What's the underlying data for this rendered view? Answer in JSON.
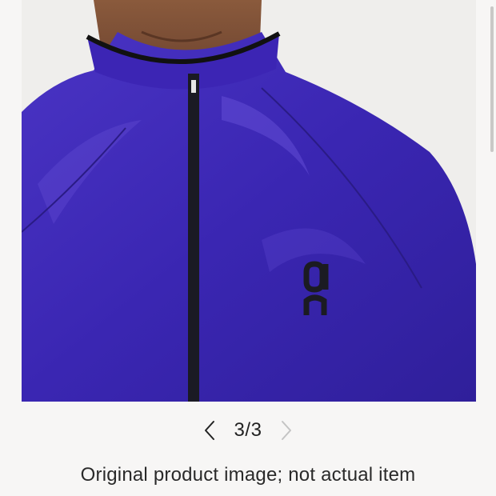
{
  "gallery": {
    "current": "3",
    "separator": "/",
    "total": "3",
    "prev_icon": "chevron-left-icon",
    "next_icon": "chevron-right-icon"
  },
  "caption": "Original product image; not actual item",
  "product_image": {
    "logo_icon": "on-brand-logo-icon",
    "jacket_color": "#3d27b4"
  },
  "colors": {
    "background": "#f7f6f5",
    "text": "#222222",
    "chevron_active": "#222222",
    "chevron_disabled": "#c4c4c4"
  }
}
